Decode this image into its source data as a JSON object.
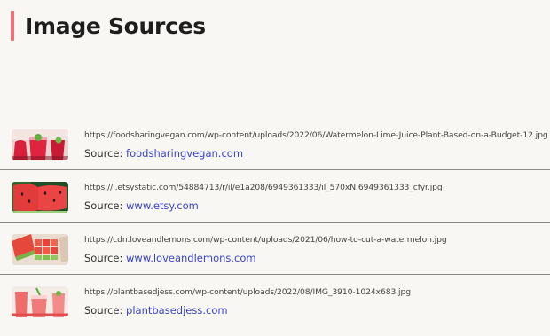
{
  "page": {
    "title": "Image Sources"
  },
  "sources": [
    {
      "url": "https://foodsharingvegan.com/wp-content/uploads/2022/06/Watermelon-Lime-Juice-Plant-Based-on-a-Budget-12.jpg",
      "source_label": "Source:",
      "domain": "foodsharingvegan.com",
      "thumb": "watermelon-juice-thumbnail"
    },
    {
      "url": "https://i.etsystatic.com/54884713/r/il/e1a208/6949361333/il_570xN.6949361333_cfyr.jpg",
      "source_label": "Source:",
      "domain": "www.etsy.com",
      "thumb": "watermelon-slice-thumbnail"
    },
    {
      "url": "https://cdn.loveandlemons.com/wp-content/uploads/2021/06/how-to-cut-a-watermelon.jpg",
      "source_label": "Source:",
      "domain": "www.loveandlemons.com",
      "thumb": "watermelon-cubes-thumbnail"
    },
    {
      "url": "https://plantbasedjess.com/wp-content/uploads/2022/08/IMG_3910-1024x683.jpg",
      "source_label": "Source:",
      "domain": "plantbasedjess.com",
      "thumb": "watermelon-drink-thumbnail"
    }
  ],
  "colors": {
    "accent": "#ef6f76",
    "link": "#3a44c8",
    "background": "#f8f7f3"
  }
}
